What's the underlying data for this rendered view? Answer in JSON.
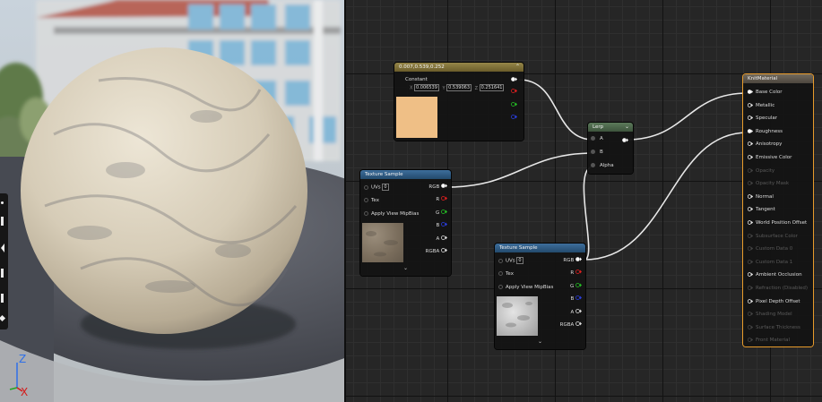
{
  "viewport": {
    "axis_z": "Z",
    "axis_x": "X",
    "icons": [
      "dot-icon",
      "bar-icon",
      "speaker-icon",
      "bar-icon",
      "bar-icon",
      "diamond-icon"
    ]
  },
  "constant_node": {
    "title": "0.007,0.539,0.252",
    "label": "Constant",
    "x_label": "X",
    "x_value": "0.006539",
    "y_label": "Y",
    "y_value": "0.539063",
    "z_label": "Z",
    "z_value": "0.251641",
    "swatch_color": "#efbf86"
  },
  "texture_sample_1": {
    "title": "Texture Sample",
    "uvs_label": "UVs",
    "uvs_value": "0",
    "tex_label": "Tex",
    "mip_label": "Apply View MipBias",
    "out_rgb": "RGB",
    "out_r": "R",
    "out_g": "G",
    "out_b": "B",
    "out_a": "A",
    "out_rgba": "RGBA"
  },
  "texture_sample_2": {
    "title": "Texture Sample",
    "uvs_label": "UVs",
    "uvs_value": "0",
    "tex_label": "Tex",
    "mip_label": "Apply View MipBias",
    "out_rgb": "RGB",
    "out_r": "R",
    "out_g": "G",
    "out_b": "B",
    "out_a": "A",
    "out_rgba": "RGBA"
  },
  "lerp_node": {
    "title": "Lerp",
    "in_a": "A",
    "in_b": "B",
    "in_alpha": "Alpha"
  },
  "result_node": {
    "title": "KnitMaterial",
    "pins": [
      {
        "label": "Base Color",
        "active": true
      },
      {
        "label": "Metallic",
        "active": true
      },
      {
        "label": "Specular",
        "active": true
      },
      {
        "label": "Roughness",
        "active": true
      },
      {
        "label": "Anisotropy",
        "active": true
      },
      {
        "label": "Emissive Color",
        "active": true
      },
      {
        "label": "Opacity",
        "active": false
      },
      {
        "label": "Opacity Mask",
        "active": false
      },
      {
        "label": "Normal",
        "active": true
      },
      {
        "label": "Tangent",
        "active": true
      },
      {
        "label": "World Position Offset",
        "active": true
      },
      {
        "label": "Subsurface Color",
        "active": false
      },
      {
        "label": "Custom Data 0",
        "active": false
      },
      {
        "label": "Custom Data 1",
        "active": false
      },
      {
        "label": "Ambient Occlusion",
        "active": true
      },
      {
        "label": "Refraction (Disabled)",
        "active": false
      },
      {
        "label": "Pixel Depth Offset",
        "active": true
      },
      {
        "label": "Shading Model",
        "active": false
      },
      {
        "label": "Surface Thickness",
        "active": false
      },
      {
        "label": "Front Material",
        "active": false
      }
    ]
  },
  "colors": {
    "accent_orange": "#e89b2b",
    "pin_red": "#e02020",
    "pin_green": "#25c025",
    "pin_blue": "#2a3ee0",
    "pin_white": "#ffffff"
  }
}
